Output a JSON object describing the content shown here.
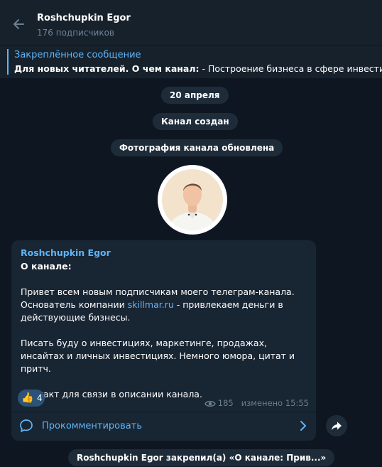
{
  "header": {
    "title": "Roshchupkin Egor",
    "subscribers": "176 подписчиков"
  },
  "pinned": {
    "label": "Закреплённое сообщение",
    "text_bold": "Для новых читателей.   О чем канал:",
    "text_rest": "  - Построение бизнеса в сфере инвестиций.  -"
  },
  "service": {
    "date": "20 апреля",
    "created": "Канал создан",
    "photo_updated": "Фотография канала обновлена",
    "pinned_notice": "Roshchupkin Egor закрепил(а) «О канале:   Прив...»"
  },
  "post": {
    "author": "Roshchupkin Egor",
    "heading": "О канале:",
    "p1_before": "Привет всем новым подписчикам моего телеграм-канала. Основатель компании ",
    "p1_link": "skillmar.ru",
    "p1_after": " - привлекаем деньги в действующие бизнесы.",
    "p2": "Писать буду о инвестициях, маркетинге, продажах, инсайтах и личных инвестициях. Немного юмора, цитат и притч.",
    "p3": "Контакт для связи в описании канала.",
    "reaction_emoji": "👍",
    "reaction_count": "4",
    "views": "185",
    "edited": "изменено 15:55",
    "comment_label": "Прокомментировать"
  },
  "colors": {
    "background": "#0e1621",
    "panel": "#17212b",
    "bubble": "#182533",
    "accent": "#5eb5f7",
    "muted": "#708499"
  },
  "icons": [
    "back-arrow-icon",
    "eye-icon",
    "comment-icon",
    "chevron-right-icon",
    "share-icon"
  ]
}
